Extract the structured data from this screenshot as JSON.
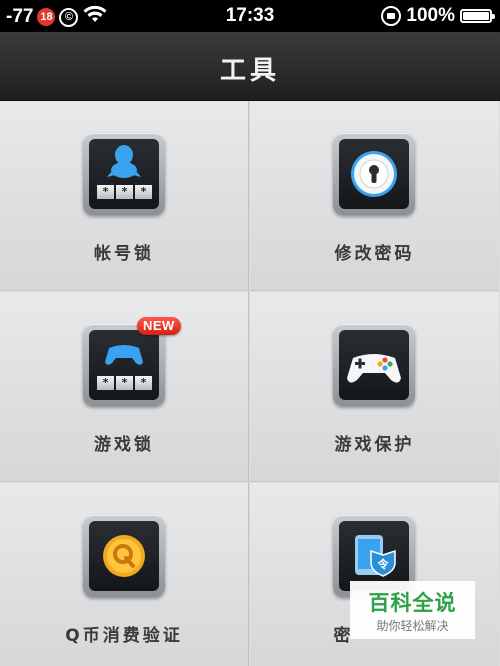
{
  "status": {
    "signal": "-77",
    "badge": "18",
    "copyright": "©",
    "time": "17:33",
    "battery": "100%"
  },
  "nav": {
    "title": "工具"
  },
  "tools": [
    {
      "label": "帐号锁",
      "icon": "account-lock-icon"
    },
    {
      "label": "修改密码",
      "icon": "change-password-icon"
    },
    {
      "label": "游戏锁",
      "icon": "game-lock-icon",
      "badge": "NEW"
    },
    {
      "label": "游戏保护",
      "icon": "game-protect-icon"
    },
    {
      "label": "Q币消费验证",
      "icon": "qcoin-verify-icon"
    },
    {
      "label": "密",
      "icon": "token-icon"
    }
  ],
  "stars": [
    "*",
    "*",
    "*"
  ],
  "watermark": {
    "big": "百科全说",
    "small": "助你轻松解决"
  },
  "colors": {
    "accent_new": "#d21f14",
    "watermark_green": "#2ba246",
    "penguin_blue": "#3aa3f0",
    "coin_gold": "#f3a91c"
  }
}
